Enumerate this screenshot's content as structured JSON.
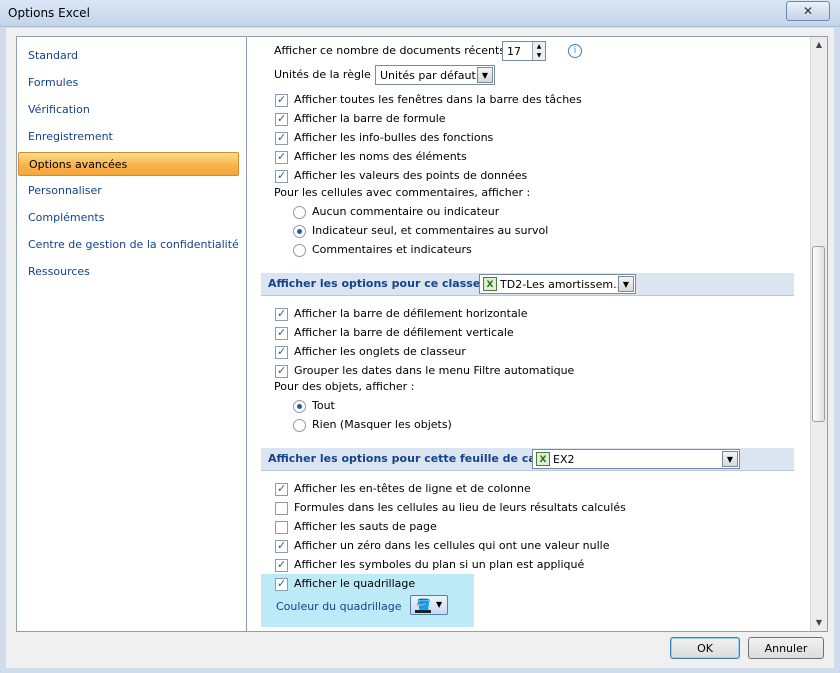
{
  "window": {
    "title": "Options Excel",
    "close": "✕"
  },
  "nav": {
    "items": [
      {
        "label": "Standard",
        "selected": false
      },
      {
        "label": "Formules",
        "selected": false
      },
      {
        "label": "Vérification",
        "selected": false
      },
      {
        "label": "Enregistrement",
        "selected": false
      },
      {
        "label": "Options avancées",
        "selected": true
      },
      {
        "label": "Personnaliser",
        "selected": false
      },
      {
        "label": "Compléments",
        "selected": false
      },
      {
        "label": "Centre de gestion de la confidentialité",
        "selected": false
      },
      {
        "label": "Ressources",
        "selected": false
      }
    ]
  },
  "top": {
    "recent_docs_label": "Afficher ce nombre de documents récents :",
    "recent_docs_value": "17",
    "ruler_units_label": "Unités de la règle",
    "ruler_units_value": "Unités par défaut"
  },
  "display_options": [
    {
      "label": "Afficher toutes les fenêtres dans la barre des tâches",
      "checked": true
    },
    {
      "label": "Afficher la barre de formule",
      "checked": true
    },
    {
      "label": "Afficher les info-bulles des fonctions",
      "checked": true
    },
    {
      "label": "Afficher les noms des éléments",
      "checked": true
    },
    {
      "label": "Afficher les valeurs des points de données",
      "checked": true
    }
  ],
  "comments": {
    "heading": "Pour les cellules avec commentaires, afficher :",
    "options": [
      {
        "label": "Aucun commentaire ou indicateur",
        "selected": false
      },
      {
        "label": "Indicateur seul, et commentaires au survol",
        "selected": true
      },
      {
        "label": "Commentaires et indicateurs",
        "selected": false
      }
    ]
  },
  "workbook_section": {
    "title": "Afficher les options pour ce classeur :",
    "workbook_value": "TD2-Les amortissem...",
    "options": [
      {
        "label": "Afficher la barre de défilement horizontale",
        "checked": true
      },
      {
        "label": "Afficher la barre de défilement verticale",
        "checked": true
      },
      {
        "label": "Afficher les onglets de classeur",
        "checked": true
      },
      {
        "label": "Grouper les dates dans le menu Filtre automatique",
        "checked": true
      }
    ],
    "objects_heading": "Pour des objets, afficher :",
    "object_options": [
      {
        "label": "Tout",
        "selected": true
      },
      {
        "label": "Rien (Masquer les objets)",
        "selected": false
      }
    ]
  },
  "sheet_section": {
    "title": "Afficher les options pour cette feuille de calcul :",
    "sheet_value": "EX2",
    "options": [
      {
        "label": "Afficher les en-têtes de ligne et de colonne",
        "checked": true
      },
      {
        "label": "Formules dans les cellules au lieu de leurs résultats calculés",
        "checked": false
      },
      {
        "label": "Afficher les sauts de page",
        "checked": false
      },
      {
        "label": "Afficher un zéro dans les cellules qui ont une valeur nulle",
        "checked": true
      },
      {
        "label": "Afficher les symboles du plan si un plan est appliqué",
        "checked": true
      },
      {
        "label": "Afficher le quadrillage",
        "checked": true
      }
    ],
    "grid_color_label": "Couleur du quadrillage",
    "highlight_color": "#bdeaf7"
  },
  "buttons": {
    "ok": "OK",
    "cancel": "Annuler"
  }
}
